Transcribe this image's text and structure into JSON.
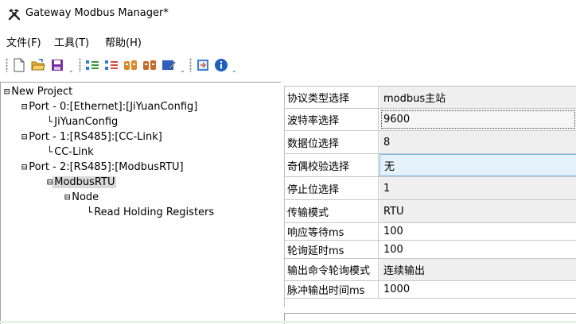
{
  "window": {
    "title": "Gateway Modbus Manager*",
    "icon": "tools-icon"
  },
  "menu": [
    {
      "label": "文件(F)"
    },
    {
      "label": "工具(T)"
    },
    {
      "label": "帮助(H)"
    }
  ],
  "toolbar": {
    "buttons": [
      "new-file-icon",
      "open-folder-icon",
      "save-icon",
      "add-port-icon",
      "add-node-icon",
      "add-command-icon",
      "remove-command-icon",
      "edit-icon",
      "export-icon",
      "info-icon"
    ]
  },
  "tree": {
    "root": "New Project",
    "port0": "Port - 0:[Ethernet]:[JiYuanConfig]",
    "port0_child": "JiYuanConfig",
    "port1": "Port - 1:[RS485]:[CC-Link]",
    "port1_child": "CC-Link",
    "port2": "Port - 2:[RS485]:[ModbusRTU]",
    "modbus": "ModbusRTU",
    "node": "Node",
    "command": "Read Holding Registers"
  },
  "properties": [
    {
      "key": "协议类型选择",
      "value": "modbus主站"
    },
    {
      "key": "波特率选择",
      "value": "9600"
    },
    {
      "key": "数据位选择",
      "value": "8"
    },
    {
      "key": "奇偶校验选择",
      "value": "无"
    },
    {
      "key": "停止位选择",
      "value": "1"
    },
    {
      "key": "传输模式",
      "value": "RTU"
    },
    {
      "key": "响应等待ms",
      "value": "100"
    },
    {
      "key": "轮询延时ms",
      "value": "100"
    },
    {
      "key": "输出命令轮询模式",
      "value": "连续输出"
    },
    {
      "key": "脉冲输出时间ms",
      "value": "1000"
    }
  ]
}
